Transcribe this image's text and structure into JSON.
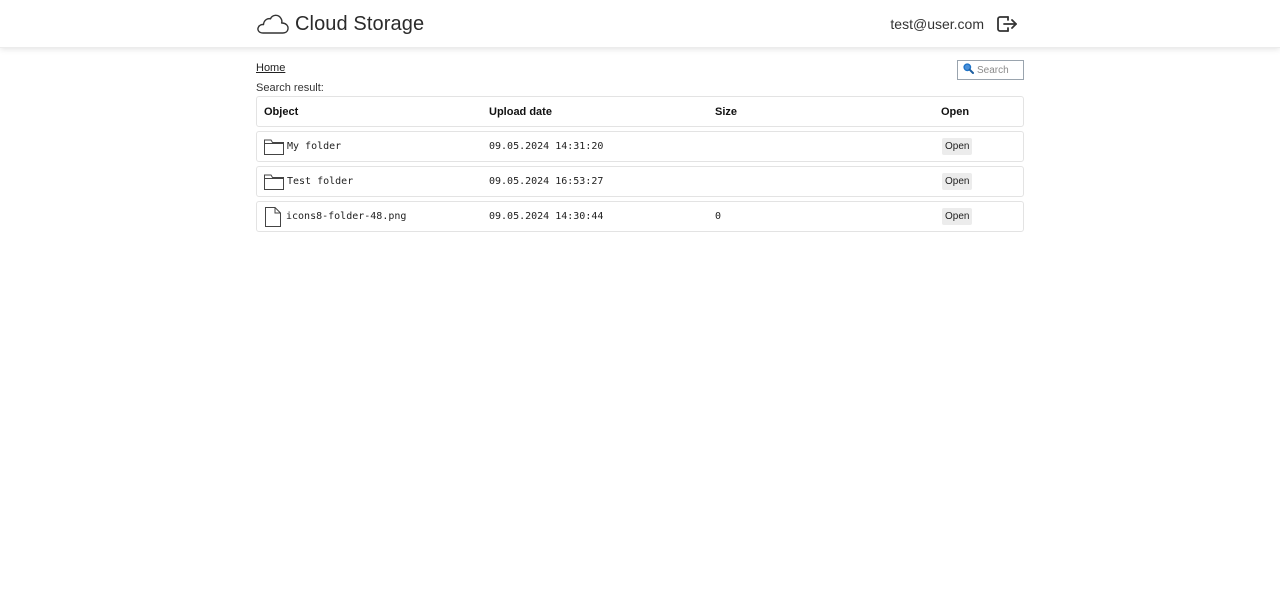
{
  "header": {
    "app_name": "Cloud Storage",
    "user_email": "test@user.com",
    "logo_icon": "cloud-icon",
    "logout_icon": "logout-icon"
  },
  "breadcrumb": {
    "home_label": "Home"
  },
  "search": {
    "placeholder": "Search",
    "icon": "search-icon"
  },
  "result_label": "Search result:",
  "table": {
    "columns": {
      "object": "Object",
      "upload_date": "Upload date",
      "size": "Size",
      "open": "Open"
    },
    "rows": [
      {
        "type": "folder",
        "icon": "folder-icon",
        "name": "My folder",
        "upload_date": "09.05.2024 14:31:20",
        "size": "",
        "open_label": "Open"
      },
      {
        "type": "folder",
        "icon": "folder-icon",
        "name": "Test folder",
        "upload_date": "09.05.2024 16:53:27",
        "size": "",
        "open_label": "Open"
      },
      {
        "type": "file",
        "icon": "file-icon",
        "name": "icons8-folder-48.png",
        "upload_date": "09.05.2024 14:30:44",
        "size": "0",
        "open_label": "Open"
      }
    ]
  },
  "colors": {
    "search_icon": "#1e73c8",
    "button_bg": "#ececec",
    "row_border": "#e3e3e3"
  }
}
